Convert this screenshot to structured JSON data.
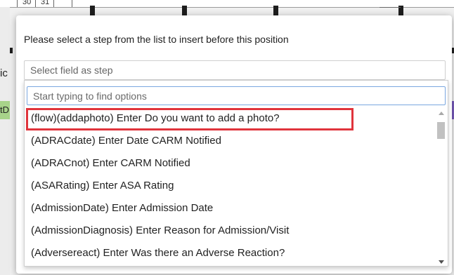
{
  "background": {
    "table_cells": [
      "30",
      "31"
    ],
    "side_label_top": "ic",
    "side_label_green": "tD"
  },
  "dialog": {
    "prompt": "Please select a step from the list to insert before this position",
    "select": {
      "placeholder": "Select field as step"
    },
    "search": {
      "placeholder": "Start typing to find options",
      "value": ""
    },
    "options": [
      {
        "label": "(flow)(addaphoto) Enter Do you want to add a photo?",
        "highlighted": true
      },
      {
        "label": "(ADRACdate) Enter Date CARM Notified",
        "highlighted": false
      },
      {
        "label": "(ADRACnot) Enter CARM Notified",
        "highlighted": false
      },
      {
        "label": "(ASARating) Enter ASA Rating",
        "highlighted": false
      },
      {
        "label": "(AdmissionDate) Enter Admission Date",
        "highlighted": false
      },
      {
        "label": "(AdmissionDiagnosis) Enter Reason for Admission/Visit",
        "highlighted": false
      },
      {
        "label": "(Adversereact) Enter Was there an Adverse Reaction?",
        "highlighted": false
      }
    ],
    "highlight_color": "#e0343c",
    "focus_color": "#7aa7e0"
  }
}
